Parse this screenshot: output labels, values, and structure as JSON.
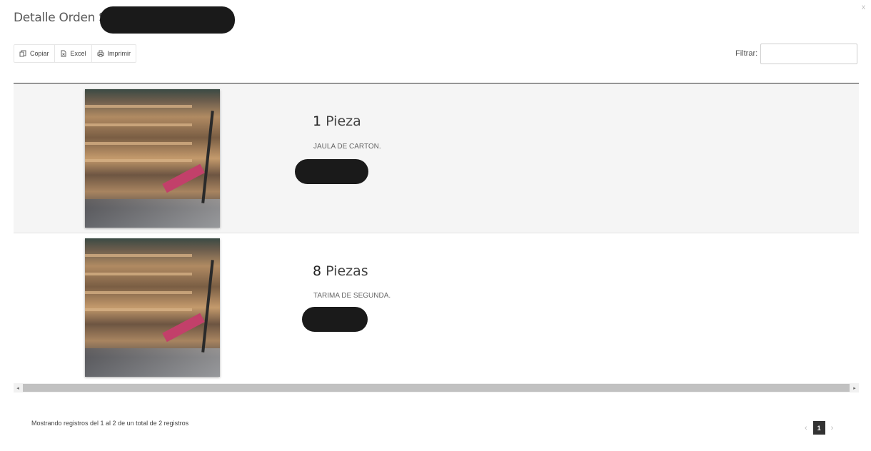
{
  "modal": {
    "title": "Detalle Orden Salida",
    "close_label": "x"
  },
  "toolbar": {
    "buttons": [
      {
        "label": "Copiar",
        "icon": "copy-icon"
      },
      {
        "label": "Excel",
        "icon": "file-excel-icon"
      },
      {
        "label": "Imprimir",
        "icon": "print-icon"
      }
    ]
  },
  "filter": {
    "label": "Filtrar:",
    "value": ""
  },
  "table": {
    "rows": [
      {
        "quantity": "1",
        "unit": "Pieza",
        "description": "JAULA DE CARTON.",
        "image": "pallets-photo"
      },
      {
        "quantity": "8",
        "unit": "Piezas",
        "description": "TARIMA DE SEGUNDA.",
        "image": "pallets-photo"
      }
    ]
  },
  "scrollbar": {
    "left_arrow": "◂",
    "right_arrow": "▸"
  },
  "footer": {
    "info": "Mostrando registros del 1 al 2 de un total de 2 registros",
    "pagination": {
      "prev": "‹",
      "current": "1",
      "next": "›"
    }
  },
  "colors": {
    "redaction": "#1a1a1a",
    "active_page": "#333333",
    "divider": "#333333"
  }
}
